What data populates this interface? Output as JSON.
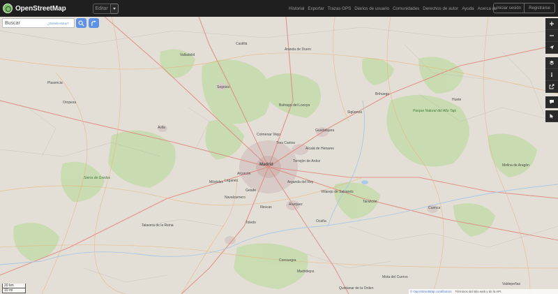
{
  "header": {
    "brand": "OpenStreetMap",
    "edit_label": "Editar",
    "nav": [
      "Historial",
      "Exportar",
      "Trazas GPS",
      "Diarios de usuario",
      "Comunidades",
      "Derechos de autor",
      "Ayuda",
      "Acerca de"
    ],
    "login_label": "Iniciar sesión",
    "register_label": "Registrarse"
  },
  "search": {
    "placeholder": "Buscar",
    "where_label": "¿Dónde estoy?"
  },
  "controls": [
    "zoom-in",
    "zoom-out",
    "locate",
    "layers",
    "legend",
    "share",
    "note",
    "query"
  ],
  "scale": {
    "km_label": "20 km",
    "mi_label": "10 mi"
  },
  "attribution": {
    "text": "© OpenStreetMap contributors",
    "extra": "Términos del sitio web y de la API"
  },
  "places": [
    "Castilla",
    "Aranda de Duero",
    "Valladolid",
    "Segovia",
    "Ávila",
    "Madrid",
    "Alcalá de Henares",
    "Guadalajara",
    "Toledo",
    "Aranjuez",
    "Talavera de la Reina",
    "Cuenca",
    "Sigüenza",
    "Arganda del Rey",
    "Getafe",
    "Leganés",
    "Alcorcón",
    "Móstoles",
    "Colmenar Viejo",
    "Tres Cantos",
    "Torrejón de Ardoz",
    "Parque Natural del Alto Tajo",
    "Sierra de Gredos",
    "Ocaña",
    "Tarancón",
    "Brihuega",
    "Buitrago del Lozoya",
    "Navalcarnero",
    "Illescas",
    "Villarejo de Salvanés",
    "Huete",
    "Molina de Aragón",
    "Plasencia",
    "Oropesa",
    "Consuegra",
    "Madridejos",
    "Quintanar de la Orden",
    "Mota del Cuervo",
    "Valdepeñas"
  ]
}
